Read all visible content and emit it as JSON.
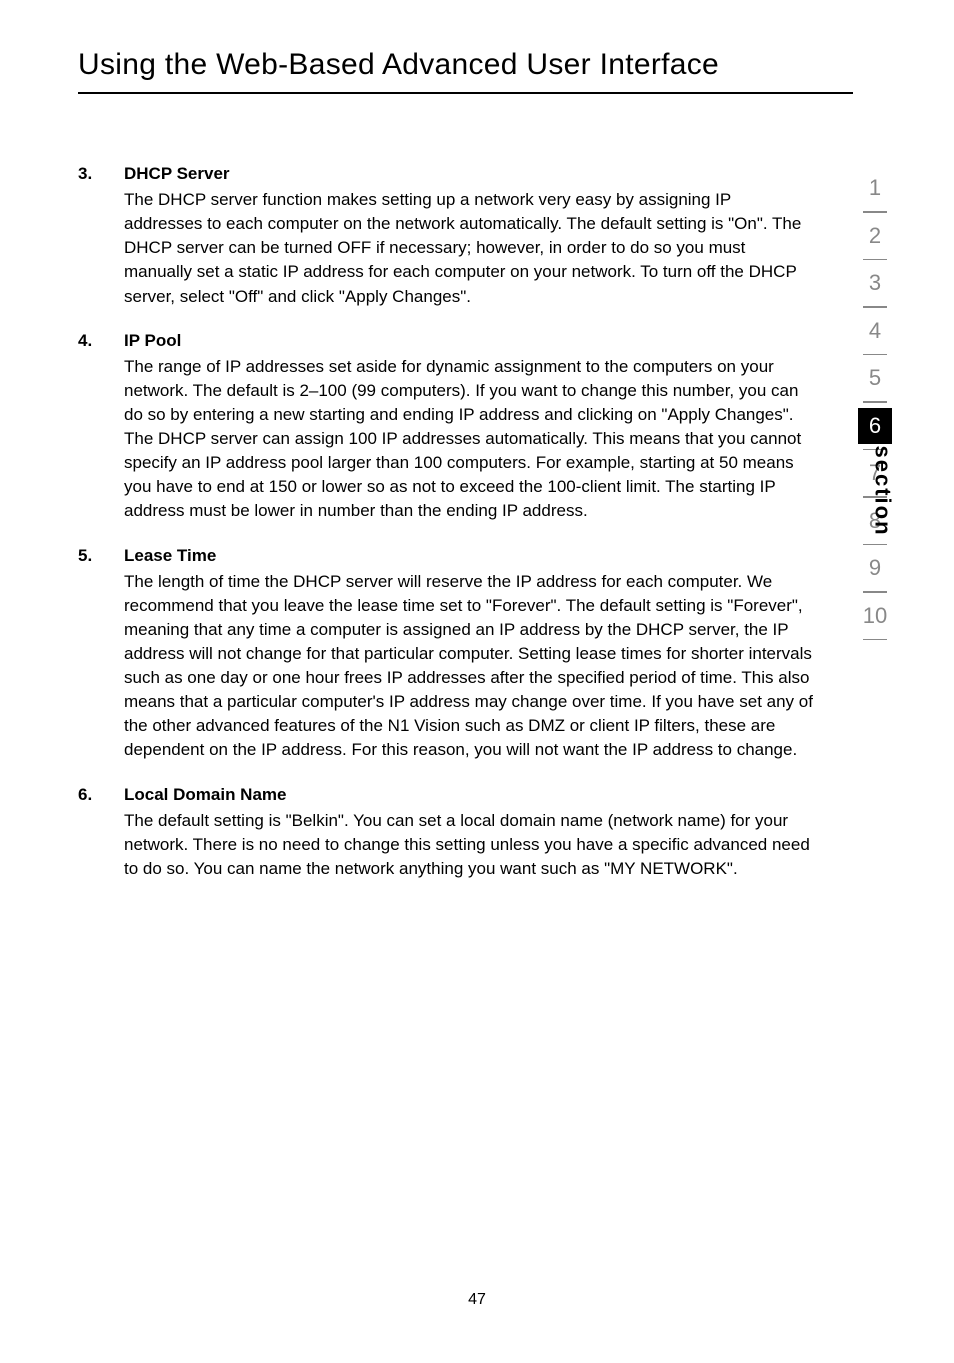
{
  "pageTitle": "Using the Web-Based Advanced User Interface",
  "items": [
    {
      "num": "3.",
      "heading": "DHCP Server",
      "text": "The DHCP server function makes setting up a network very easy by assigning IP addresses to each computer on the network automatically. The default setting is \"On\". The DHCP server can be turned OFF if necessary; however, in order to do so you must manually set a static IP address for each computer on your network. To turn off the DHCP server, select \"Off\" and click \"Apply Changes\"."
    },
    {
      "num": "4.",
      "heading": "IP Pool",
      "text": "The range of IP addresses set aside for dynamic assignment to the computers on your network. The default is 2–100 (99 computers). If you want to change this number, you can do so by entering a new starting and ending IP address and clicking on \"Apply Changes\". The DHCP server can assign 100 IP addresses automatically. This means that you cannot specify an IP address pool larger than 100 computers. For example, starting at 50 means you have to end at 150 or lower so as not to exceed the 100-client limit. The starting IP address must be lower in number than the ending IP address."
    },
    {
      "num": "5.",
      "heading": "Lease Time",
      "text": "The length of time the DHCP server will reserve the IP address for each computer. We recommend that you leave the lease time set to \"Forever\". The default setting is \"Forever\", meaning that any time a computer is assigned an IP address by the DHCP server, the IP address will not change for that particular computer. Setting lease times for shorter intervals such as one day or one hour frees IP addresses after the specified period of time. This also means that a particular computer's IP address may change over time. If you have set any of the other advanced features of the N1 Vision such as DMZ or client IP filters, these are dependent on the IP address. For this reason, you will not want the IP address to change."
    },
    {
      "num": "6.",
      "heading": "Local Domain Name",
      "text": "The default setting is \"Belkin\". You can set a local domain name (network name) for your network. There is no need to change this setting unless you have a specific advanced need to do so. You can name the network anything you want such as \"MY NETWORK\"."
    }
  ],
  "nav": {
    "items": [
      "1",
      "2",
      "3",
      "4",
      "5",
      "6",
      "7",
      "8",
      "9",
      "10"
    ],
    "activeIndex": 5,
    "label": "section"
  },
  "pageNumber": "47"
}
